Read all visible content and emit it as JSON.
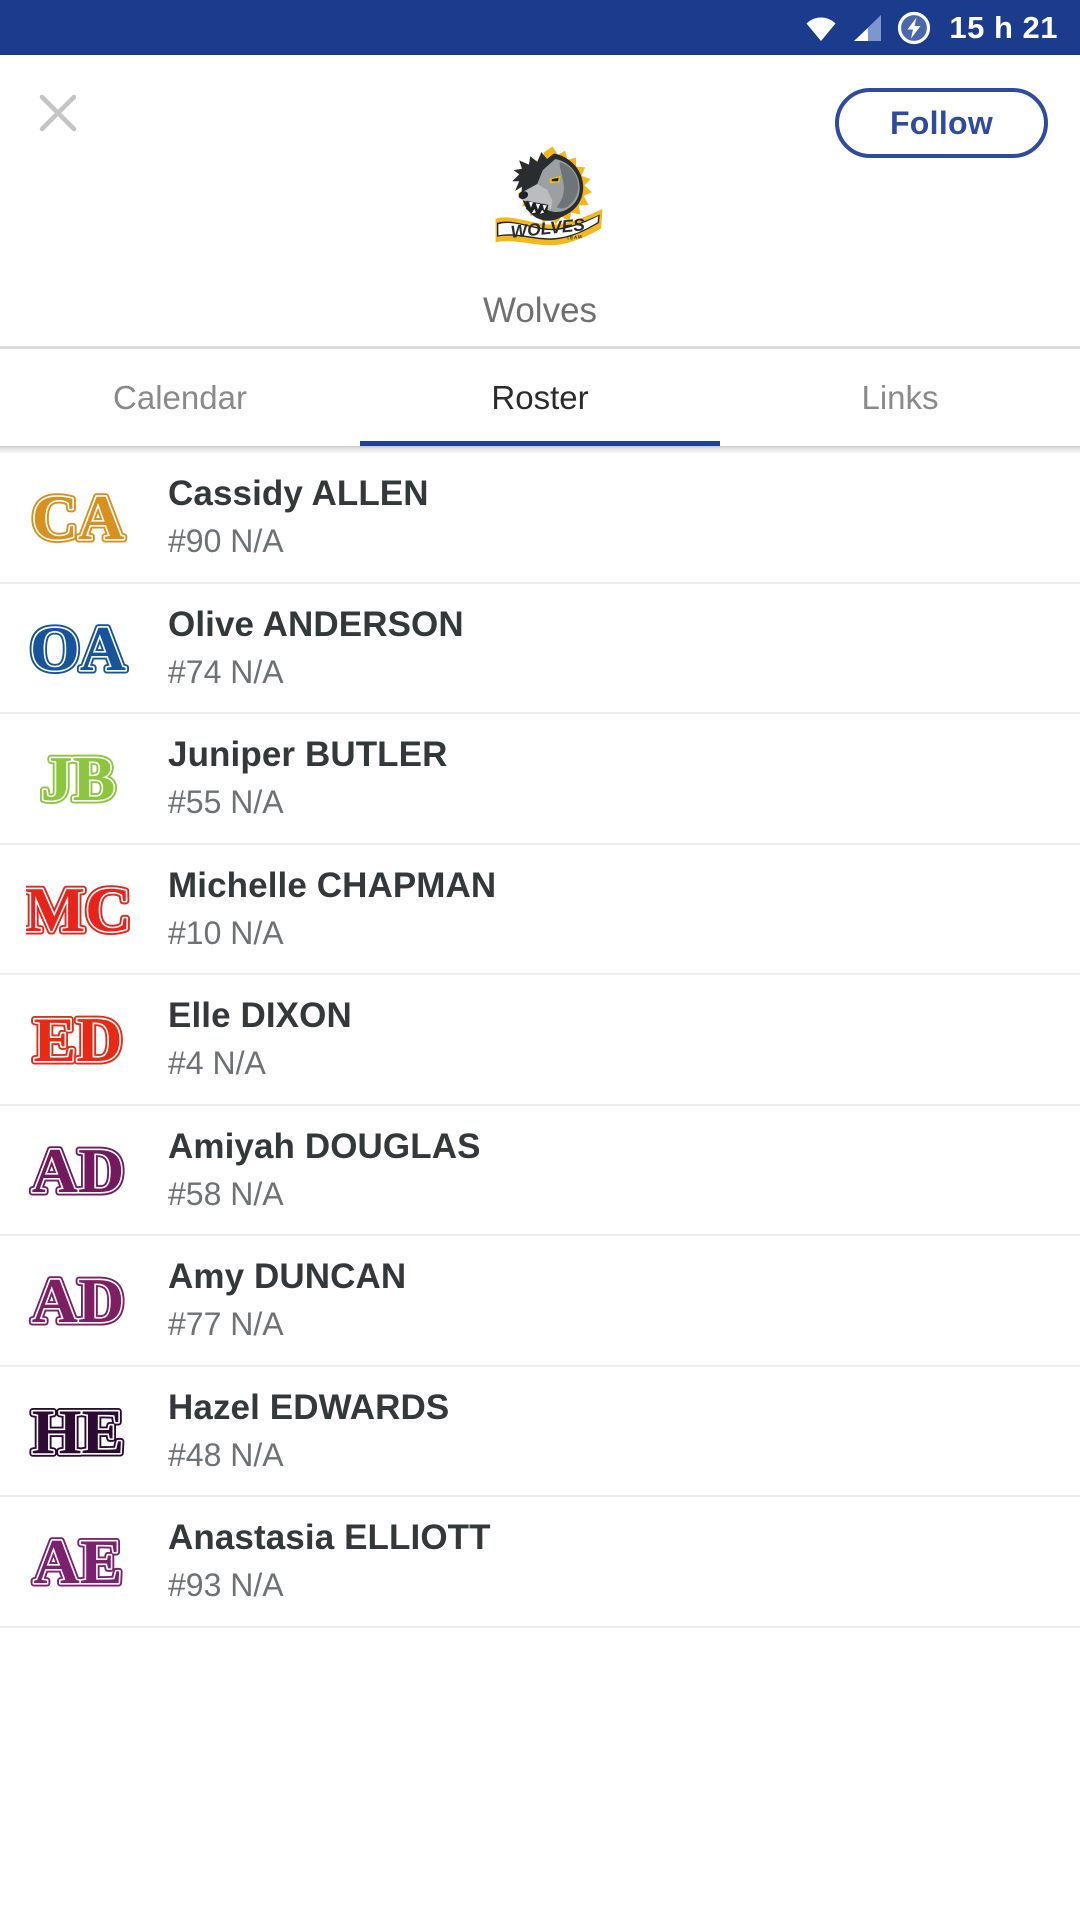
{
  "statusbar": {
    "time": "15 h 21",
    "icons": [
      "wifi-icon",
      "cellular-signal-icon",
      "battery-charging-icon"
    ],
    "background": "#1b3c8c"
  },
  "header": {
    "close_icon": "close-icon",
    "follow_label": "Follow",
    "follow_color": "#2f4ba0",
    "team_name": "Wolves",
    "crest": {
      "name": "wolves-team-logo",
      "wordmark": "WOLVES",
      "sub_wordmark": "TEAM",
      "colors": {
        "outline": "#f5b81b",
        "fur_dark": "#4d5357",
        "fur_light": "#a9adb0",
        "ink": "#1a1a1a"
      }
    }
  },
  "tabs": {
    "active_index": 1,
    "accent": "#21409a",
    "items": [
      {
        "label": "Calendar",
        "name": "tab-calendar"
      },
      {
        "label": "Roster",
        "name": "tab-roster"
      },
      {
        "label": "Links",
        "name": "tab-links"
      }
    ]
  },
  "roster": {
    "players": [
      {
        "initials": "CA",
        "name": "Cassidy ALLEN",
        "meta": "#90 N/A",
        "number": "90",
        "position": "N/A",
        "color": "#d9901e"
      },
      {
        "initials": "OA",
        "name": "Olive ANDERSON",
        "meta": "#74 N/A",
        "number": "74",
        "position": "N/A",
        "color": "#17549c"
      },
      {
        "initials": "JB",
        "name": "Juniper BUTLER",
        "meta": "#55 N/A",
        "number": "55",
        "position": "N/A",
        "color": "#8cc63e"
      },
      {
        "initials": "MC",
        "name": "Michelle CHAPMAN",
        "meta": "#10 N/A",
        "number": "10",
        "position": "N/A",
        "color": "#e8231a"
      },
      {
        "initials": "ED",
        "name": "Elle DIXON",
        "meta": "#4 N/A",
        "number": "4",
        "position": "N/A",
        "color": "#e52b15"
      },
      {
        "initials": "AD",
        "name": "Amiyah DOUGLAS",
        "meta": "#58 N/A",
        "number": "58",
        "position": "N/A",
        "color": "#731a5e"
      },
      {
        "initials": "AD",
        "name": "Amy DUNCAN",
        "meta": "#77 N/A",
        "number": "77",
        "position": "N/A",
        "color": "#7d1f63"
      },
      {
        "initials": "HE",
        "name": "Hazel EDWARDS",
        "meta": "#48 N/A",
        "number": "48",
        "position": "N/A",
        "color": "#2d0a33"
      },
      {
        "initials": "AE",
        "name": "Anastasia ELLIOTT",
        "meta": "#93 N/A",
        "number": "93",
        "position": "N/A",
        "color": "#7b2170"
      }
    ]
  }
}
